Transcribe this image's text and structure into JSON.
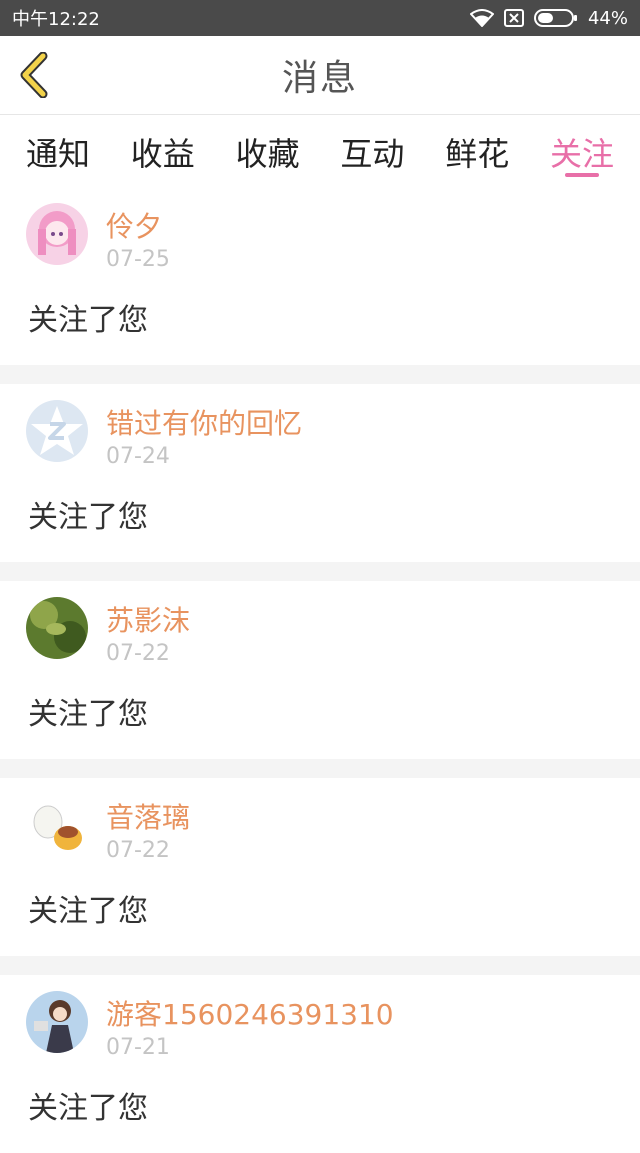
{
  "status_bar": {
    "time": "中午12:22",
    "battery": "44%",
    "icons": [
      "wifi-icon",
      "sim-disabled-icon",
      "battery-icon"
    ]
  },
  "header": {
    "title": "消息",
    "back_icon": "chevron-left-icon"
  },
  "tabs": [
    {
      "label": "通知",
      "active": false
    },
    {
      "label": "收益",
      "active": false
    },
    {
      "label": "收藏",
      "active": false
    },
    {
      "label": "互动",
      "active": false
    },
    {
      "label": "鲜花",
      "active": false
    },
    {
      "label": "关注",
      "active": true
    }
  ],
  "colors": {
    "accent": "#e86fa8",
    "name": "#e8935f",
    "date": "#c4c4c4",
    "statusbar": "#4a4a4a"
  },
  "messages": [
    {
      "name": "伶夕",
      "date": "07-25",
      "text": "关注了您"
    },
    {
      "name": "错过有你的回忆",
      "date": "07-24",
      "text": "关注了您"
    },
    {
      "name": "苏影沫",
      "date": "07-22",
      "text": "关注了您"
    },
    {
      "name": "音落璃",
      "date": "07-22",
      "text": "关注了您"
    },
    {
      "name": "游客1560246391310",
      "date": "07-21",
      "text": "关注了您"
    }
  ]
}
